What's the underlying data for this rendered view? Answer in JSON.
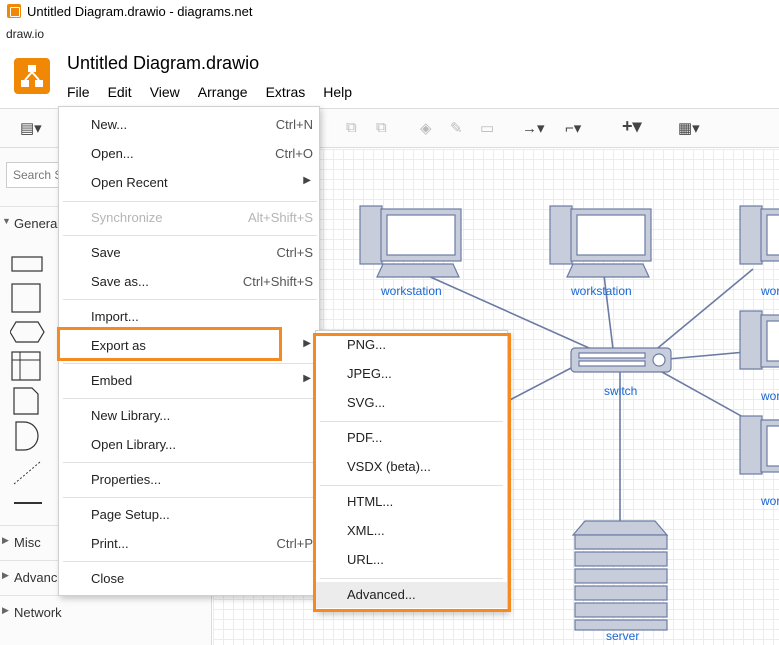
{
  "window": {
    "title": "Untitled Diagram.drawio - diagrams.net",
    "url": "draw.io"
  },
  "app": {
    "doc_title": "Untitled Diagram.drawio"
  },
  "menubar": [
    "File",
    "Edit",
    "View",
    "Arrange",
    "Extras",
    "Help"
  ],
  "sidebar": {
    "search_placeholder": "Search S",
    "sections": {
      "general": "General",
      "misc": "Misc",
      "advanced": "Advance",
      "network": "Network"
    }
  },
  "file_menu": {
    "new": {
      "label": "New...",
      "shortcut": "Ctrl+N"
    },
    "open": {
      "label": "Open...",
      "shortcut": "Ctrl+O"
    },
    "open_recent": {
      "label": "Open Recent"
    },
    "synchronize": {
      "label": "Synchronize",
      "shortcut": "Alt+Shift+S"
    },
    "save": {
      "label": "Save",
      "shortcut": "Ctrl+S"
    },
    "save_as": {
      "label": "Save as...",
      "shortcut": "Ctrl+Shift+S"
    },
    "import": {
      "label": "Import..."
    },
    "export_as": {
      "label": "Export as"
    },
    "embed": {
      "label": "Embed"
    },
    "new_library": {
      "label": "New Library..."
    },
    "open_library": {
      "label": "Open Library..."
    },
    "properties": {
      "label": "Properties..."
    },
    "page_setup": {
      "label": "Page Setup..."
    },
    "print": {
      "label": "Print...",
      "shortcut": "Ctrl+P"
    },
    "close": {
      "label": "Close"
    }
  },
  "export_menu": {
    "png": "PNG...",
    "jpeg": "JPEG...",
    "svg": "SVG...",
    "pdf": "PDF...",
    "vsdx": "VSDX (beta)...",
    "html": "HTML...",
    "xml": "XML...",
    "url": "URL...",
    "advanced": "Advanced..."
  },
  "diagram": {
    "workstation_1": "workstation",
    "workstation_2": "workstation",
    "switch": "switch",
    "server": "server",
    "partial_1": "wor",
    "partial_2": "wor",
    "partial_3": "wor"
  },
  "colors": {
    "accent": "#f08705",
    "highlight": "#f58a21",
    "link_text": "#1967d2",
    "node_fill": "#c8cddc",
    "node_stroke": "#6b7ba3"
  }
}
